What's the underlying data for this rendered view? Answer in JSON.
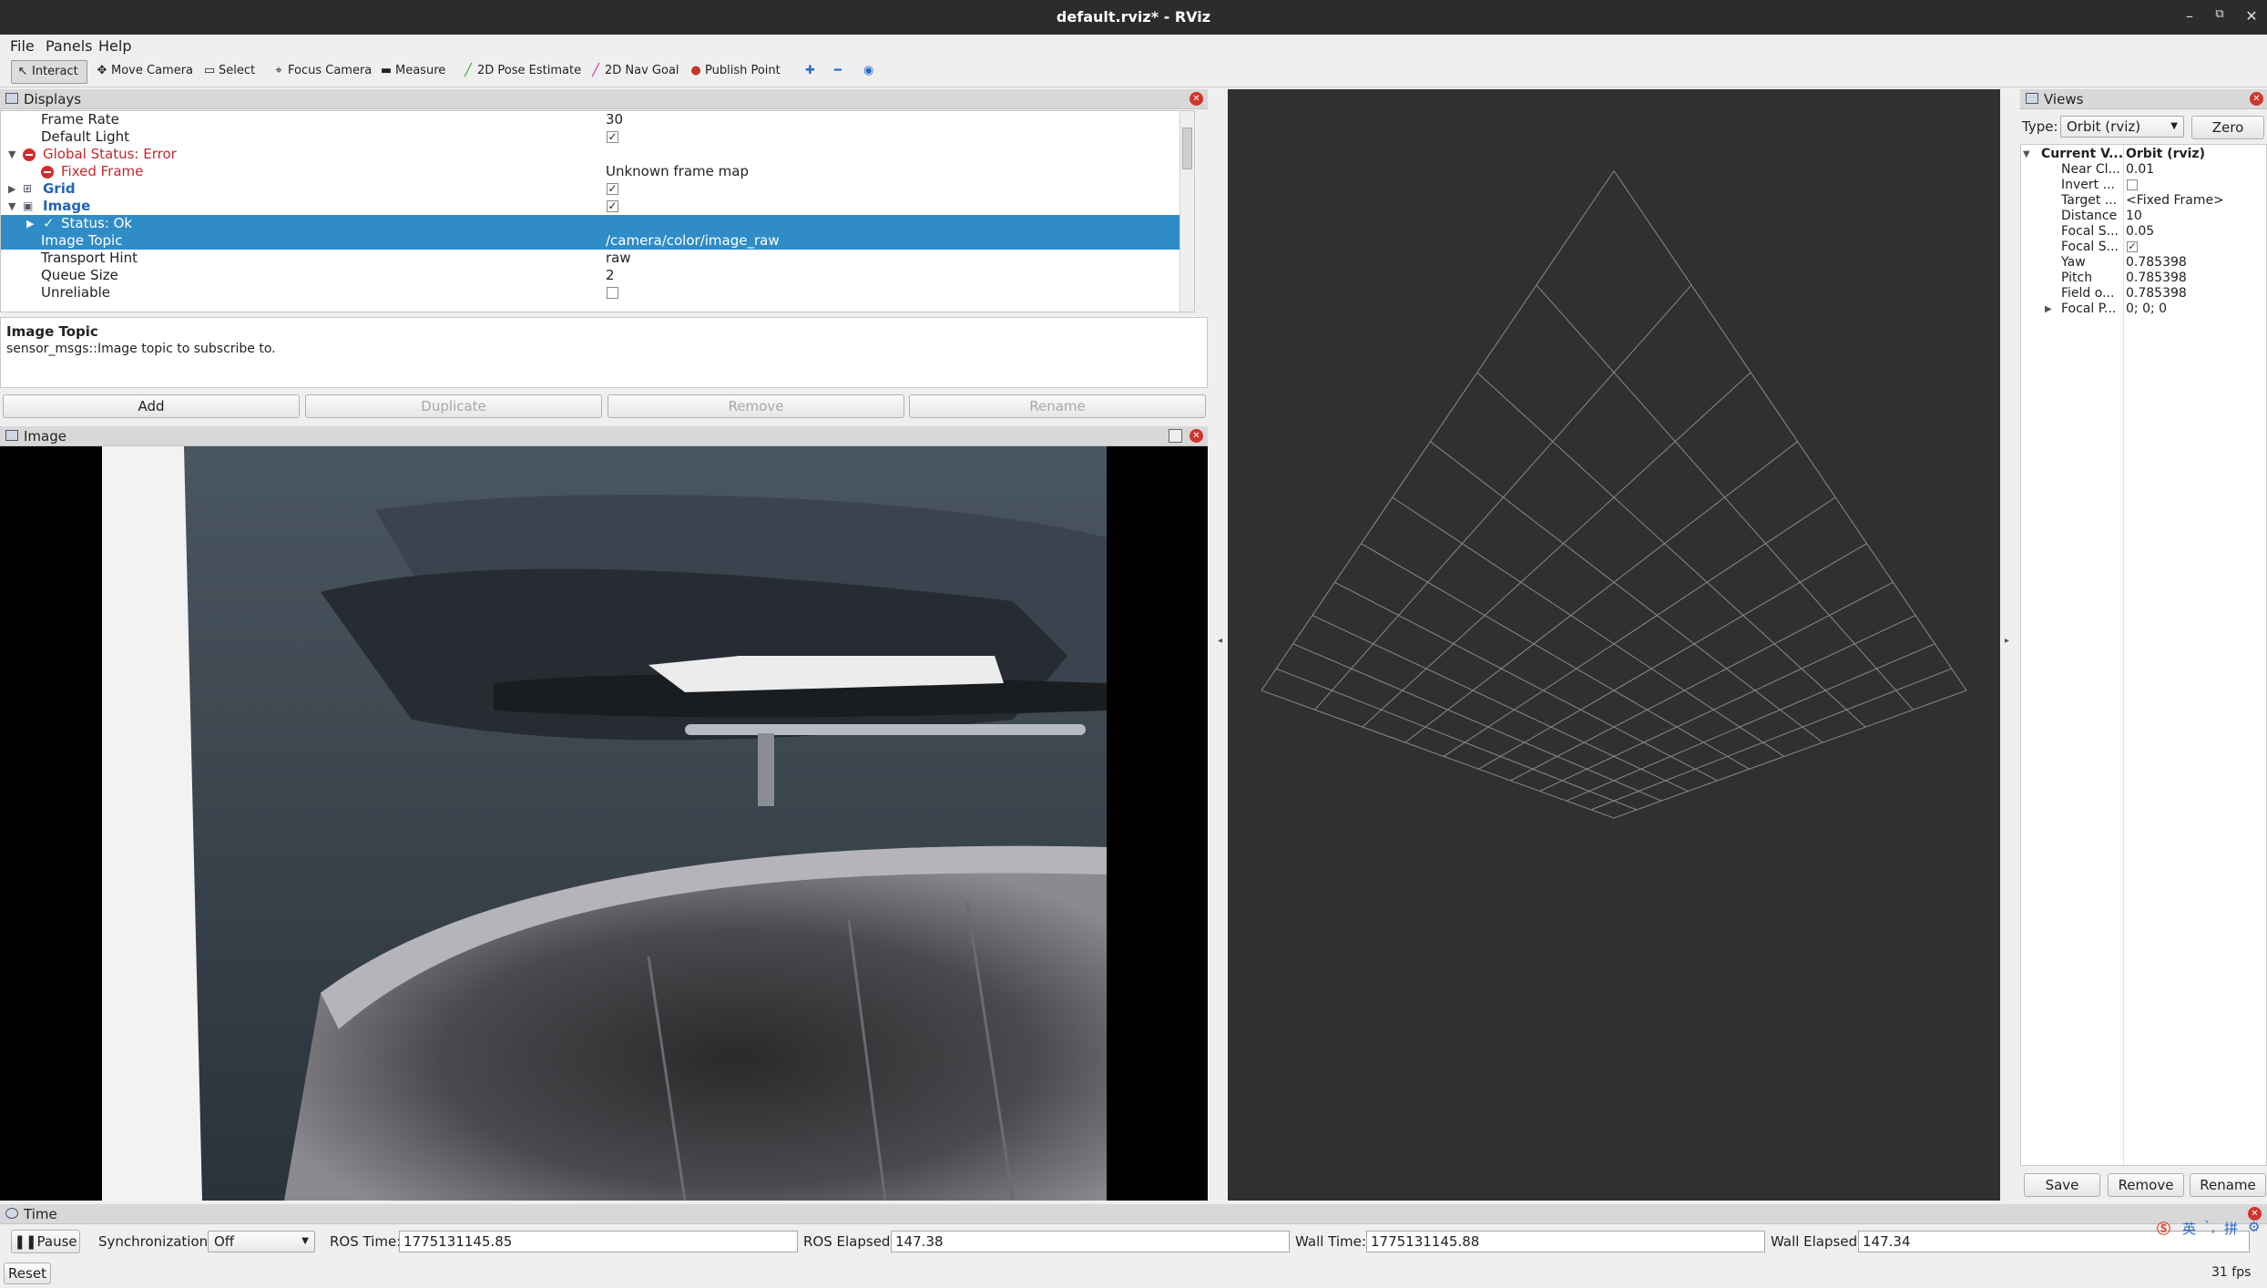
{
  "window": {
    "title": "default.rviz* - RViz"
  },
  "menu": {
    "file": "File",
    "panels": "Panels",
    "help": "Help"
  },
  "toolbar": {
    "interact": "Interact",
    "move_camera": "Move Camera",
    "select": "Select",
    "focus_camera": "Focus Camera",
    "measure": "Measure",
    "pose_estimate": "2D Pose Estimate",
    "nav_goal": "2D Nav Goal",
    "publish_point": "Publish Point"
  },
  "displays": {
    "title": "Displays",
    "rows": [
      {
        "name": "Frame Rate",
        "value": "30"
      },
      {
        "name": "Default Light",
        "value": "✓"
      },
      {
        "name": "Global Status: Error",
        "value": ""
      },
      {
        "name": "Fixed Frame",
        "value": "Unknown frame map"
      },
      {
        "name": "Grid",
        "value": "✓"
      },
      {
        "name": "Image",
        "value": "✓"
      },
      {
        "name": "Status: Ok",
        "value": ""
      },
      {
        "name": "Image Topic",
        "value": "/camera/color/image_raw"
      },
      {
        "name": "Transport Hint",
        "value": "raw"
      },
      {
        "name": "Queue Size",
        "value": "2"
      },
      {
        "name": "Unreliable",
        "value": ""
      }
    ],
    "description_title": "Image Topic",
    "description_text": "sensor_msgs::Image topic to subscribe to.",
    "buttons": {
      "add": "Add",
      "duplicate": "Duplicate",
      "remove": "Remove",
      "rename": "Rename"
    }
  },
  "image_panel": {
    "title": "Image"
  },
  "views": {
    "title": "Views",
    "type_label": "Type:",
    "type_value": "Orbit (rviz)",
    "zero": "Zero",
    "rows": [
      {
        "name": "Current V...",
        "value": "Orbit (rviz)"
      },
      {
        "name": "Near Cl...",
        "value": "0.01"
      },
      {
        "name": "Invert ...",
        "value": ""
      },
      {
        "name": "Target ...",
        "value": "<Fixed Frame>"
      },
      {
        "name": "Distance",
        "value": "10"
      },
      {
        "name": "Focal S...",
        "value": "0.05"
      },
      {
        "name": "Focal S...",
        "value": "✓"
      },
      {
        "name": "Yaw",
        "value": "0.785398"
      },
      {
        "name": "Pitch",
        "value": "0.785398"
      },
      {
        "name": "Field o...",
        "value": "0.785398"
      },
      {
        "name": "Focal P...",
        "value": "0; 0; 0"
      }
    ],
    "buttons": {
      "save": "Save",
      "remove": "Remove",
      "rename": "Rename"
    }
  },
  "time": {
    "title": "Time",
    "pause": "Pause",
    "sync_label": "Synchronization:",
    "sync_value": "Off",
    "ros_time_label": "ROS Time:",
    "ros_time": "1775131145.85",
    "ros_elapsed_label": "ROS Elapsed:",
    "ros_elapsed": "147.38",
    "wall_time_label": "Wall Time:",
    "wall_time": "1775131145.88",
    "wall_elapsed_label": "Wall Elapsed:",
    "wall_elapsed": "147.34",
    "reset": "Reset",
    "fps": "31 fps"
  },
  "ime": {
    "lang": "英",
    "pinyin": "拼"
  },
  "colors": {
    "selection": "#308cc6",
    "error": "#c0282c",
    "view_bg": "#303030"
  }
}
